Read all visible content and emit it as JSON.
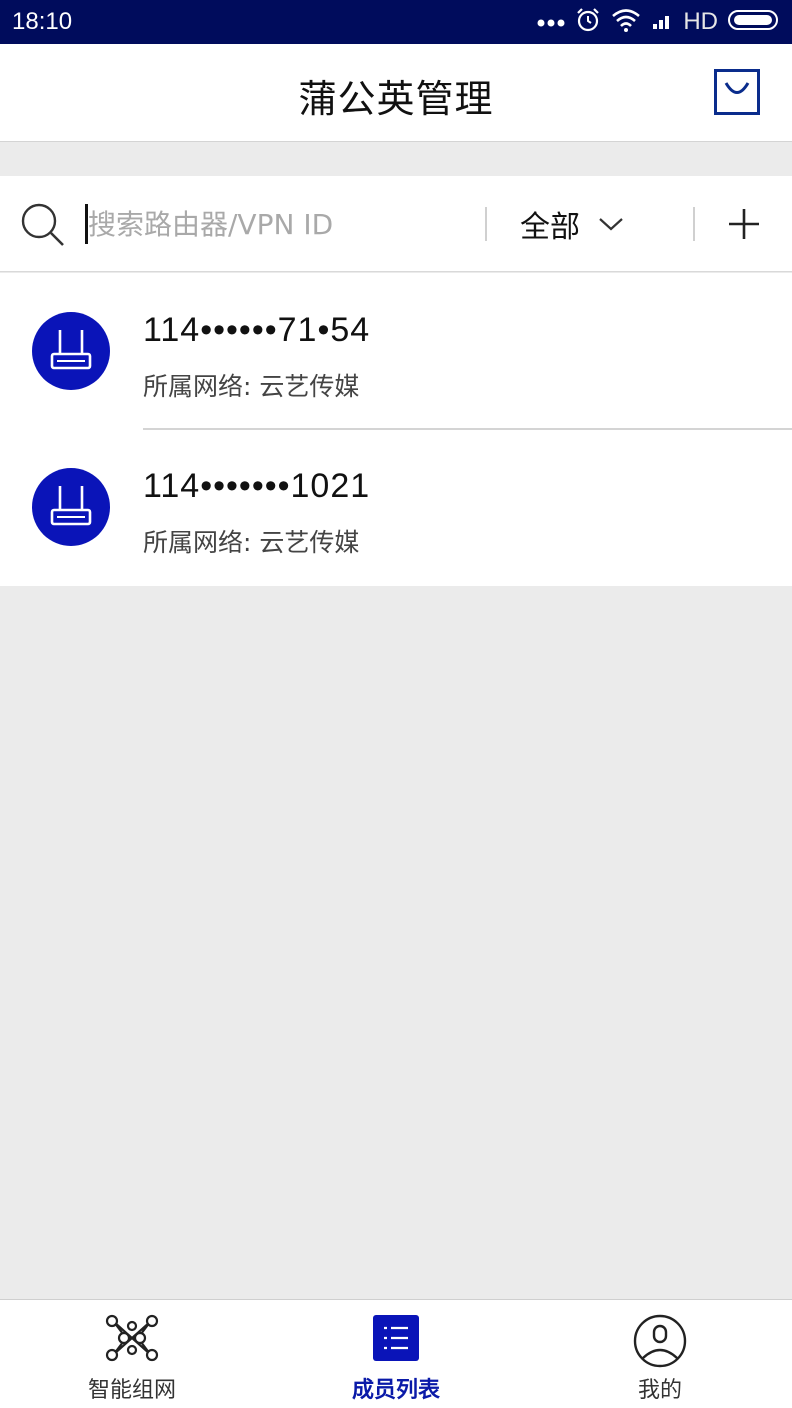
{
  "status_bar": {
    "time": "18:10",
    "network": "HD",
    "icons": [
      "more-dots-icon",
      "alarm-icon",
      "wifi-icon",
      "signal-icon",
      "battery-icon"
    ]
  },
  "header": {
    "title": "蒲公英管理",
    "action_icon": "scan-bag-icon"
  },
  "search": {
    "placeholder": "搜索路由器/VPN ID",
    "value": "",
    "filter_label": "全部",
    "add_icon": "plus-icon"
  },
  "members": [
    {
      "id": "114••••••71•54",
      "network": "所属网络: 云艺传媒",
      "icon": "router-icon"
    },
    {
      "id": "114•••••••1021",
      "network": "所属网络: 云艺传媒",
      "icon": "router-icon"
    }
  ],
  "tabs": [
    {
      "label": "智能组网",
      "icon": "network-nodes-icon",
      "active": false
    },
    {
      "label": "成员列表",
      "icon": "list-icon",
      "active": true
    },
    {
      "label": "我的",
      "icon": "user-icon",
      "active": false
    }
  ],
  "colors": {
    "status_bar": "#000c5c",
    "accent": "#0a14b8",
    "background": "#ebebeb"
  }
}
